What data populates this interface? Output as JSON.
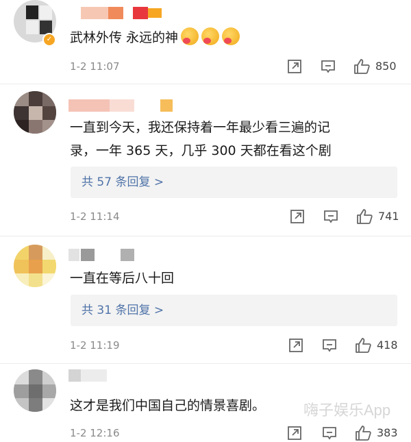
{
  "comments": [
    {
      "text_lines": [
        "武林外传 永远的神"
      ],
      "emoji_count": 3,
      "emoji_name": "kiss-emoji",
      "time": "1-2 11:07",
      "likes": "850",
      "reply_label": ""
    },
    {
      "text_lines": [
        "一直到今天，我还保持着一年最少看三遍的记",
        "录，一年 365 天，几乎 300 天都在看这个剧"
      ],
      "time": "1-2 11:14",
      "likes": "741",
      "reply_label": "共 57 条回复 >"
    },
    {
      "text_lines": [
        "一直在等后八十回"
      ],
      "time": "1-2 11:19",
      "likes": "418",
      "reply_label": "共 31 条回复 >"
    },
    {
      "text_lines": [
        "这才是我们中国自己的情景喜剧。"
      ],
      "time": "1-2 12:16",
      "likes": "383",
      "reply_label": ""
    }
  ],
  "watermark": "嗨子娱乐App",
  "colors": {
    "reply_link": "#4f73a8",
    "meta_gray": "#8a8a8a",
    "reply_bg": "#f3f3f3",
    "verified_badge": "#f6a623"
  },
  "icons": [
    "share-icon",
    "comment-icon",
    "thumbs-up-icon"
  ]
}
